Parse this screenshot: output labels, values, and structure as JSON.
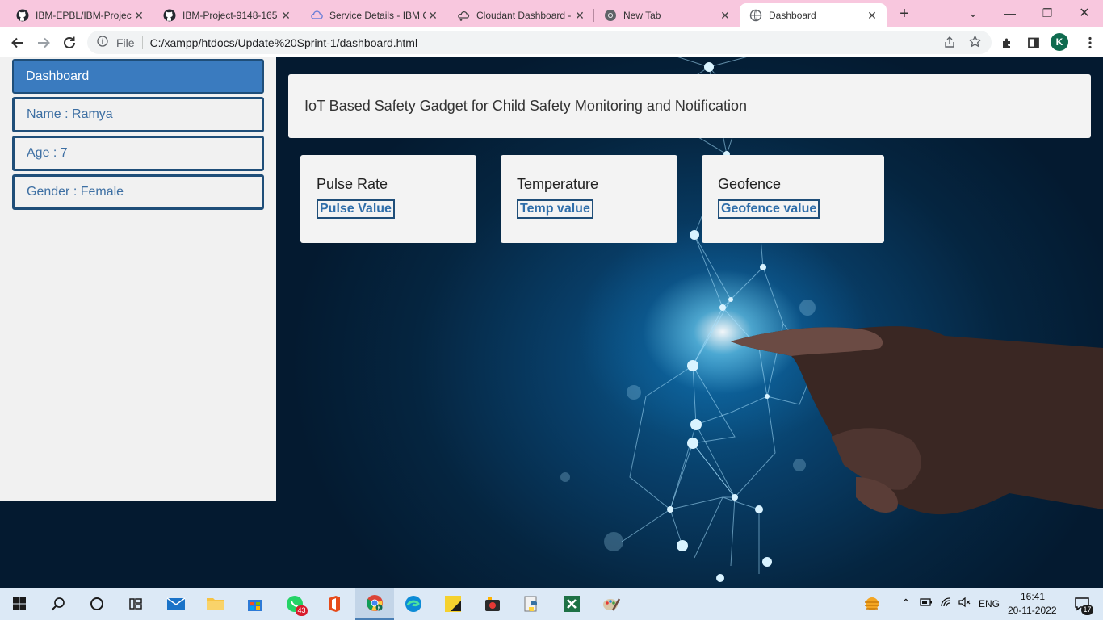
{
  "browser": {
    "tabs": [
      {
        "title": "IBM-EPBL/IBM-Project",
        "favicon": "github-icon"
      },
      {
        "title": "IBM-Project-9148-165",
        "favicon": "github-icon"
      },
      {
        "title": "Service Details - IBM C",
        "favicon": "cloud-icon"
      },
      {
        "title": "Cloudant Dashboard -",
        "favicon": "cloudant-icon"
      },
      {
        "title": "New Tab",
        "favicon": "chrome-icon"
      },
      {
        "title": "Dashboard",
        "favicon": "globe-icon"
      }
    ],
    "active_tab_index": 5,
    "address": {
      "scheme_label": "File",
      "url": "C:/xampp/htdocs/Update%20Sprint-1/dashboard.html"
    },
    "profile_initial": "K"
  },
  "sidebar": {
    "items": [
      {
        "label": "Dashboard",
        "active": true
      },
      {
        "label": "Name : Ramya",
        "active": false
      },
      {
        "label": "Age : 7",
        "active": false
      },
      {
        "label": "Gender : Female",
        "active": false
      }
    ]
  },
  "header": {
    "title": "IoT Based Safety Gadget for Child Safety Monitoring and Notification"
  },
  "cards": [
    {
      "title": "Pulse Rate",
      "value": "Pulse Value"
    },
    {
      "title": "Temperature",
      "value": "Temp value"
    },
    {
      "title": "Geofence",
      "value": "Geofence value"
    }
  ],
  "taskbar": {
    "apps": [
      "windows-start-icon",
      "search-icon",
      "cortana-icon",
      "task-view-icon",
      "mail-icon",
      "file-explorer-icon",
      "microsoft-store-icon",
      "whatsapp-icon",
      "office-icon",
      "chrome-icon",
      "edge-icon",
      "sticky-notes-icon",
      "media-app-icon",
      "python-icon",
      "excel-icon",
      "paint-icon"
    ],
    "whatsapp_badge": "43",
    "language": "ENG",
    "time": "16:41",
    "date": "20-11-2022",
    "notification_count": "17",
    "colors": {
      "taskbar_bg": "#dce9f6",
      "accent": "#1f4e79"
    }
  }
}
